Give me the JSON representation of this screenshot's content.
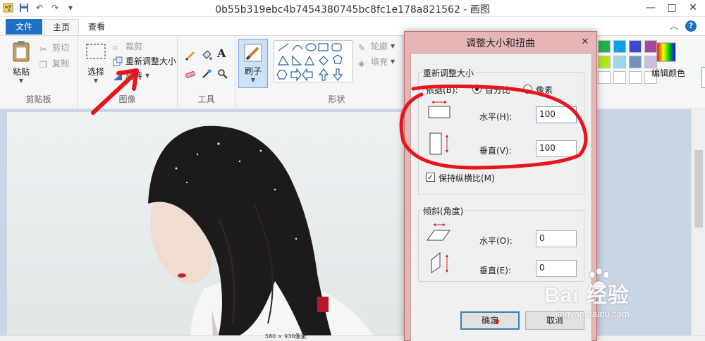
{
  "window": {
    "title": "0b55b319ebc4b7454380745bc8fc1e178a821562 - 画图",
    "minimize": "—",
    "maximize": "□",
    "close": "✕"
  },
  "tabs": {
    "file": "文件",
    "home": "主页",
    "view": "查看",
    "help": "?",
    "collapse": "︿"
  },
  "ribbon": {
    "clipboard": {
      "label": "剪贴板",
      "paste": "粘贴",
      "cut": "剪切",
      "copy": "复制"
    },
    "image": {
      "label": "图像",
      "select": "选择",
      "crop": "裁剪",
      "resize": "重新调整大小",
      "rotate": "旋转"
    },
    "tools": {
      "label": "工具",
      "text_icon": "A"
    },
    "brush": {
      "label": "刷子"
    },
    "shapes": {
      "label": "形状",
      "outline": "轮廓",
      "fill": "填充"
    },
    "colors": {
      "edit": "编辑颜色",
      "swatches": [
        "#22b14c",
        "#00a2e8",
        "#3f48cc",
        "#a349a4",
        "#b5e61d",
        "#99d9ea",
        "#7092be",
        "#c8bfe7",
        "#ffffff",
        "#ffffff",
        "#ffffff",
        "#ffffff"
      ]
    }
  },
  "dialog": {
    "title": "调整大小和扭曲",
    "close": "✕",
    "resize": {
      "legend": "重新调整大小",
      "by_label": "依据(B):",
      "percent": "百分比",
      "pixels": "像素",
      "horizontal_label": "水平(H):",
      "horizontal_value": "100",
      "vertical_label": "垂直(V):",
      "vertical_value": "100",
      "keep_ratio": "保持纵横比(M)"
    },
    "skew": {
      "legend": "倾斜(角度)",
      "horizontal_label": "水平(O):",
      "horizontal_value": "0",
      "vertical_label": "垂直(E):",
      "vertical_value": "0"
    },
    "ok": "确定",
    "cancel": "取消"
  },
  "status": {
    "dimensions": "580 × 930像素"
  },
  "watermark": {
    "brand": "Bai  经验",
    "url": "jingyan.baidu.com"
  },
  "annotation_color": "#e8141b"
}
